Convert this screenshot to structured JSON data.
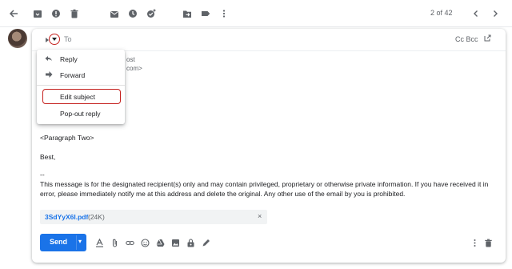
{
  "toolbar": {
    "icons": [
      "back-arrow-icon",
      "archive-icon",
      "report-spam-icon",
      "delete-icon",
      "mark-unread-icon",
      "snooze-icon",
      "add-task-icon",
      "move-to-icon",
      "label-icon",
      "more-vert-icon"
    ],
    "pager_text": "2 of 42"
  },
  "compose": {
    "to_label": "To",
    "cc_bcc": "Cc Bcc",
    "partial_line_1": "ost",
    "partial_line_2": "com>",
    "paragraph_two": "<Paragraph Two>",
    "closing": "Best,",
    "signature_sep": "--",
    "disclaimer_line_1": "This message is for the designated recipient(s) only and may contain privileged, proprietary or otherwise private information. If you have received it in",
    "disclaimer_line_2": "error, please immediately notify me at this address and delete the original. Any other use of the email by you is prohibited."
  },
  "attachment": {
    "name": "3SdYyX6I.pdf",
    "size": "(24K)"
  },
  "send": {
    "label": "Send"
  },
  "menu": {
    "items": [
      {
        "label": "Reply",
        "icon": "reply-icon"
      },
      {
        "label": "Forward",
        "icon": "forward-icon"
      },
      {
        "label": "Edit subject",
        "icon": ""
      },
      {
        "label": "Pop-out reply",
        "icon": ""
      }
    ]
  },
  "colors": {
    "accent": "#1a73e8",
    "highlight": "#c5221f"
  }
}
